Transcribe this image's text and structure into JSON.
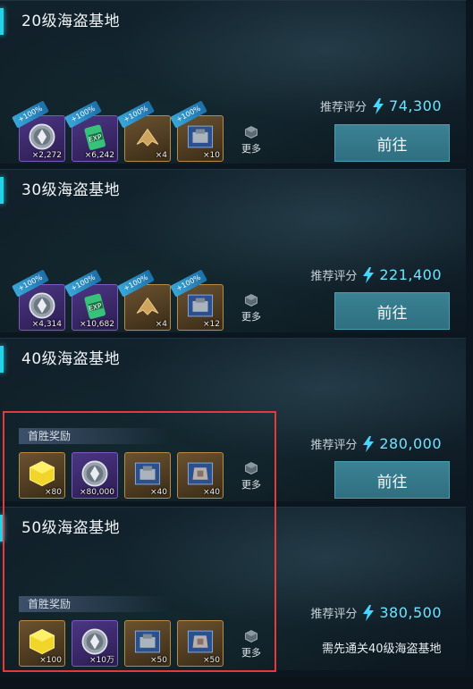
{
  "panels": [
    {
      "title": "20级海盗基地",
      "rating_label": "推荐评分",
      "rating_value": "74,300",
      "button_label": "前往",
      "more_label": "更多",
      "bonus_label": "+100%",
      "items": [
        {
          "icon": "silver-medal-icon",
          "count": "×2,272",
          "rarity": "purple"
        },
        {
          "icon": "exp-potion-icon",
          "count": "×6,242",
          "rarity": "purple"
        },
        {
          "icon": "fighter-ship-icon",
          "count": "×4",
          "rarity": "gold"
        },
        {
          "icon": "turret-blueprint-icon",
          "count": "×10",
          "rarity": "gold"
        }
      ]
    },
    {
      "title": "30级海盗基地",
      "rating_label": "推荐评分",
      "rating_value": "221,400",
      "button_label": "前往",
      "more_label": "更多",
      "bonus_label": "+100%",
      "items": [
        {
          "icon": "silver-medal-icon",
          "count": "×4,314",
          "rarity": "purple"
        },
        {
          "icon": "exp-potion-icon",
          "count": "×10,682",
          "rarity": "purple"
        },
        {
          "icon": "fighter-ship-icon",
          "count": "×4",
          "rarity": "gold"
        },
        {
          "icon": "turret-blueprint-icon",
          "count": "×12",
          "rarity": "gold"
        }
      ]
    },
    {
      "title": "40级海盗基地",
      "rating_label": "推荐评分",
      "rating_value": "280,000",
      "button_label": "前往",
      "first_win_label": "首胜奖励",
      "more_label": "更多",
      "items": [
        {
          "icon": "gold-cube-icon",
          "count": "×80",
          "rarity": "gold"
        },
        {
          "icon": "silver-medal-icon",
          "count": "×80,000",
          "rarity": "purple"
        },
        {
          "icon": "turret-blueprint-icon",
          "count": "×40",
          "rarity": "gold"
        },
        {
          "icon": "armor-blueprint-icon",
          "count": "×40",
          "rarity": "gold"
        }
      ]
    },
    {
      "title": "50级海盗基地",
      "rating_label": "推荐评分",
      "rating_value": "380,500",
      "requirement": "需先通关40级海盗基地",
      "first_win_label": "首胜奖励",
      "more_label": "更多",
      "items": [
        {
          "icon": "gold-cube-icon",
          "count": "×100",
          "rarity": "gold"
        },
        {
          "icon": "silver-medal-icon",
          "count": "×10万",
          "rarity": "purple"
        },
        {
          "icon": "turret-blueprint-icon",
          "count": "×50",
          "rarity": "gold"
        },
        {
          "icon": "armor-blueprint-icon",
          "count": "×50",
          "rarity": "gold"
        }
      ]
    }
  ],
  "colors": {
    "accent": "#24d3e8",
    "button": "#2f6f80",
    "rating_value": "#6fe3ff",
    "highlight": "#e33a3a"
  }
}
